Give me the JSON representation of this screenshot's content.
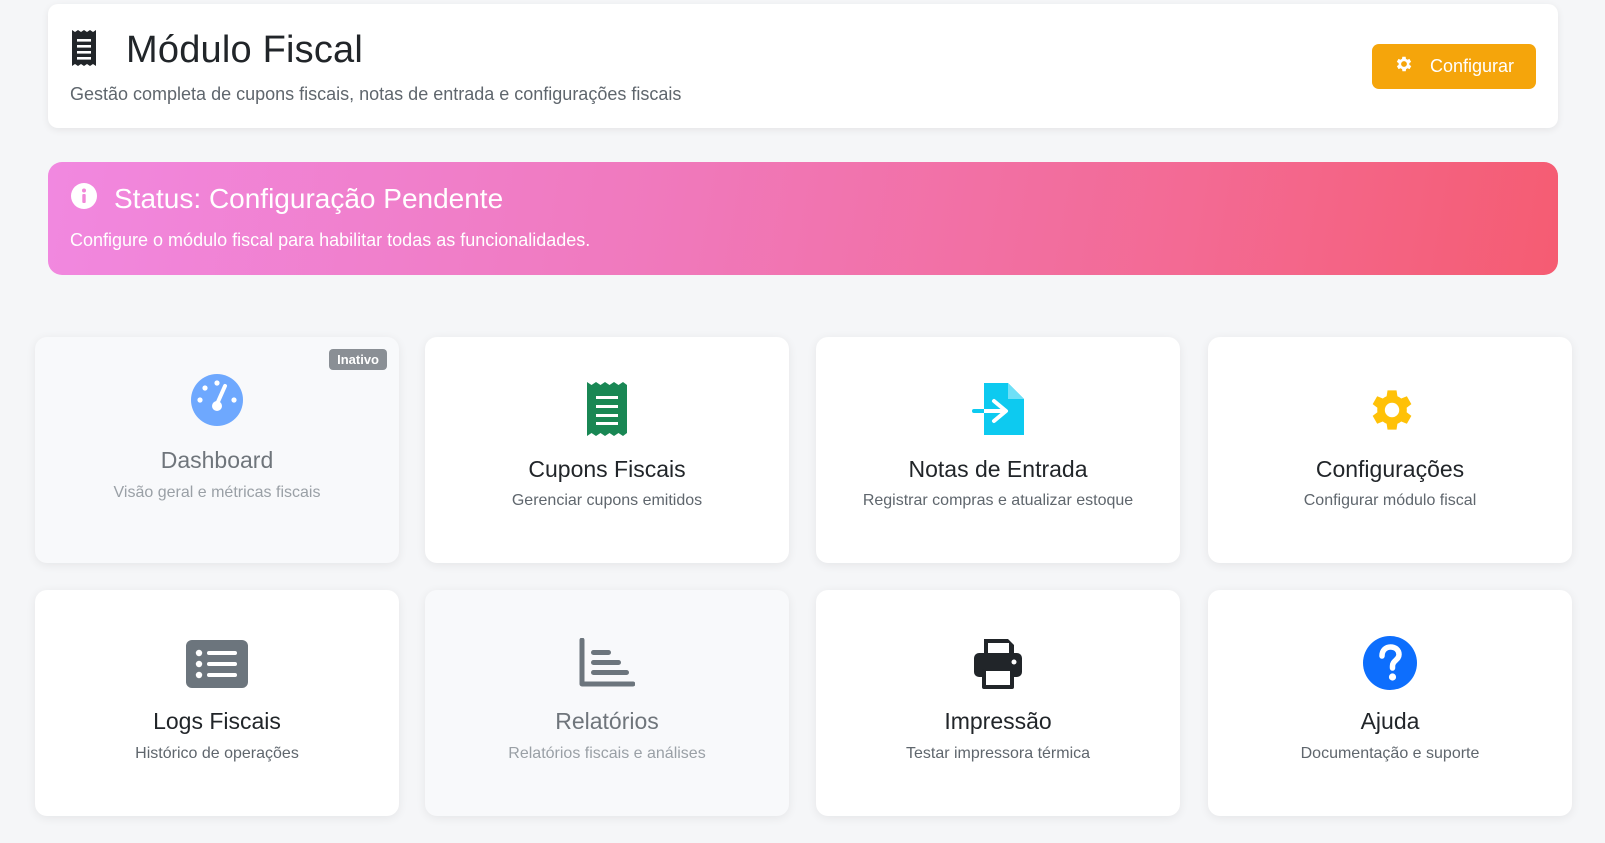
{
  "header": {
    "title": "Módulo Fiscal",
    "subtitle": "Gestão completa de cupons fiscais, notas de entrada e configurações fiscais",
    "icon": "receipt-icon",
    "configure_button": "Configurar"
  },
  "status": {
    "title": "Status: Configuração Pendente",
    "message": "Configure o módulo fiscal para habilitar todas as funcionalidades.",
    "icon": "info-icon"
  },
  "cards": [
    {
      "title": "Dashboard",
      "description": "Visão geral e métricas fiscais",
      "icon": "speedometer-icon",
      "icon_color": "#6ea8fe",
      "badge": "Inativo",
      "inactive": true
    },
    {
      "title": "Cupons Fiscais",
      "description": "Gerenciar cupons emitidos",
      "icon": "receipt-icon",
      "icon_color": "#198754"
    },
    {
      "title": "Notas de Entrada",
      "description": "Registrar compras e atualizar estoque",
      "icon": "file-import-icon",
      "icon_color": "#0dcaf0"
    },
    {
      "title": "Configurações",
      "description": "Configurar módulo fiscal",
      "icon": "gear-icon",
      "icon_color": "#ffc107"
    },
    {
      "title": "Logs Fiscais",
      "description": "Histórico de operações",
      "icon": "list-icon",
      "icon_color": "#6c757d"
    },
    {
      "title": "Relatórios",
      "description": "Relatórios fiscais e análises",
      "icon": "bar-chart-icon",
      "icon_color": "#6c757d",
      "inactive": true
    },
    {
      "title": "Impressão",
      "description": "Testar impressora térmica",
      "icon": "printer-icon",
      "icon_color": "#212529"
    },
    {
      "title": "Ajuda",
      "description": "Documentação e suporte",
      "icon": "question-circle-icon",
      "icon_color": "#0d6efd"
    }
  ],
  "colors": {
    "accent_button": "#f5a50b",
    "banner_gradient_start": "#f188e0",
    "banner_gradient_end": "#f55c72"
  }
}
